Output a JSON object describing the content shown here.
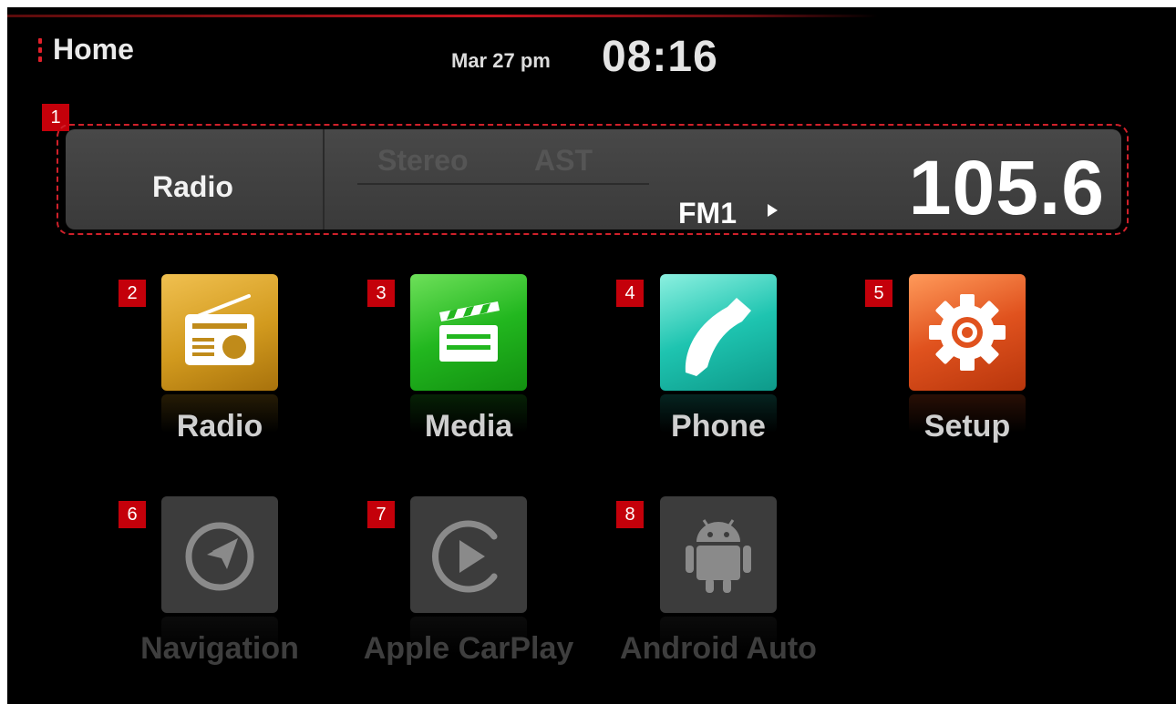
{
  "header": {
    "title": "Home",
    "date": "Mar 27 pm",
    "time": "08:16"
  },
  "radio_widget": {
    "label": "Radio",
    "stereo": "Stereo",
    "ast": "AST",
    "band": "FM1",
    "frequency": "105.6"
  },
  "markers": [
    "1",
    "2",
    "3",
    "4",
    "5",
    "6",
    "7",
    "8"
  ],
  "apps": [
    {
      "label": "Radio",
      "icon": "radio-icon",
      "enabled": true
    },
    {
      "label": "Media",
      "icon": "clapperboard-icon",
      "enabled": true
    },
    {
      "label": "Phone",
      "icon": "phone-handset-icon",
      "enabled": true
    },
    {
      "label": "Setup",
      "icon": "gear-icon",
      "enabled": true
    },
    {
      "label": "Navigation",
      "icon": "compass-icon",
      "enabled": false
    },
    {
      "label": "Apple CarPlay",
      "icon": "play-circle-icon",
      "enabled": false
    },
    {
      "label": "Android Auto",
      "icon": "android-robot-icon",
      "enabled": false
    }
  ],
  "colors": {
    "accent_red": "#c4000a",
    "radio_tile": "#d29a1e",
    "media_tile": "#22b71f",
    "phone_tile": "#1ec4b0",
    "setup_tile": "#e0521e",
    "disabled_tile": "#3c3c3c"
  }
}
